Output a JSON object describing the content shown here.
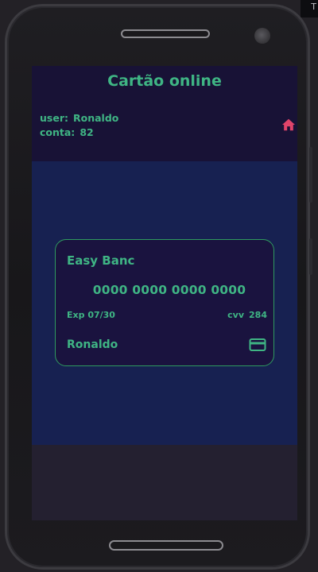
{
  "header": {
    "title": "Cartão online",
    "user_label": "user:",
    "user_value": "Ronaldo",
    "account_label": "conta:",
    "account_value": "82",
    "home_icon": "home-icon"
  },
  "card": {
    "bank_name": "Easy Banc",
    "number": "0000 0000 0000 0000",
    "expiry": "Exp 07/30",
    "cvv_label": "cvv",
    "cvv_value": "284",
    "holder": "Ronaldo",
    "card_icon": "credit-card-icon"
  },
  "corner_glyph": "T",
  "colors": {
    "accent": "#3fb584",
    "home_icon": "#e0446a",
    "header_bg": "#181236",
    "main_bg": "#172151",
    "card_bg": "#1a133f",
    "card_border": "#2f9b5f"
  }
}
